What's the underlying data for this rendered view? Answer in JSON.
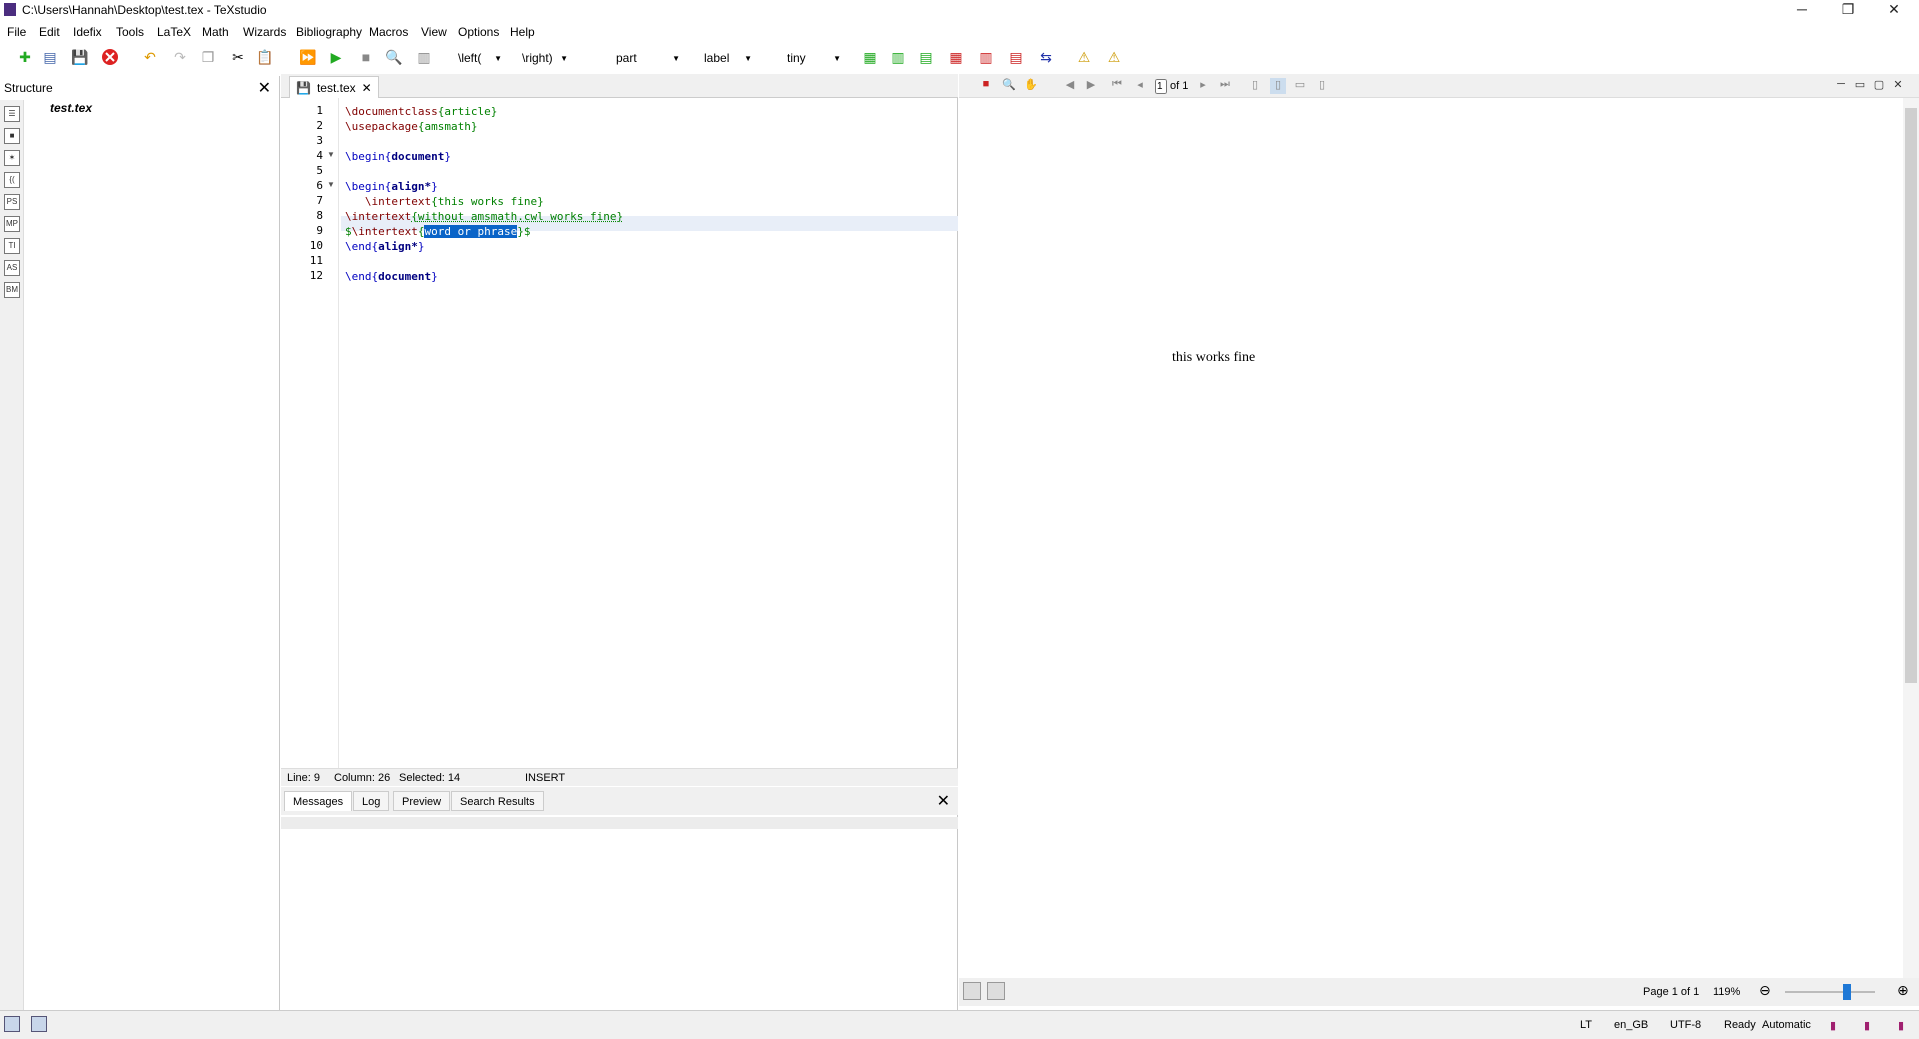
{
  "window": {
    "title": "C:\\Users\\Hannah\\Desktop\\test.tex - TeXstudio"
  },
  "menu": [
    "File",
    "Edit",
    "Idefix",
    "Tools",
    "LaTeX",
    "Math",
    "Wizards",
    "Bibliography",
    "Macros",
    "View",
    "Options",
    "Help"
  ],
  "toolbar": {
    "left_delim": "\\left(",
    "right_delim": "\\right)",
    "sectioning": "part",
    "reference": "label",
    "size": "tiny"
  },
  "structure": {
    "title": "Structure",
    "file": "test.tex"
  },
  "editor": {
    "tab_label": "test.tex",
    "line_numbers": [
      "1",
      "2",
      "3",
      "4",
      "5",
      "6",
      "7",
      "8",
      "9",
      "10",
      "11",
      "12"
    ],
    "status": {
      "line": "Line: 9",
      "column": "Column: 26",
      "selected": "Selected: 14",
      "mode": "INSERT"
    }
  },
  "messages": {
    "tabs": [
      "Messages",
      "Log",
      "Preview",
      "Search Results"
    ]
  },
  "pdf": {
    "page_input": "1",
    "page_of": "of 1",
    "body_text": "this works fine",
    "page_status": "Page 1 of 1",
    "zoom": "119%"
  },
  "statusbar": {
    "language": "en_GB",
    "encoding": "UTF-8",
    "state": "Ready",
    "mode": "Automatic"
  }
}
